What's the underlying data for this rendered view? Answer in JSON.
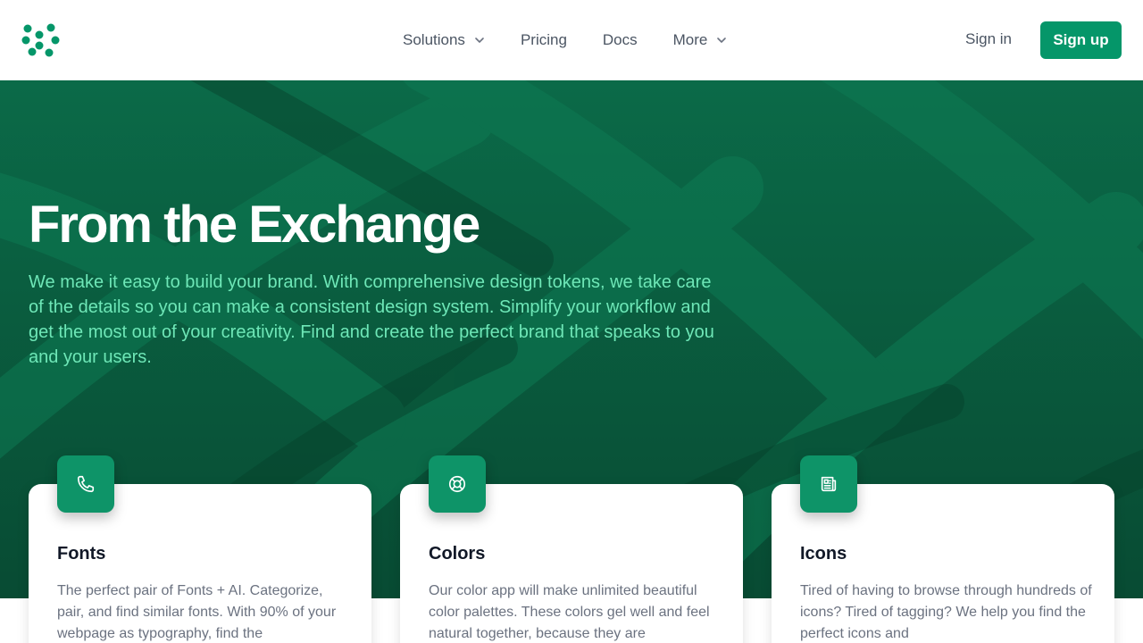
{
  "colors": {
    "brand": "#059669",
    "hero_bg": "#0a5a3e",
    "hero_text": "#6ee7b7"
  },
  "nav": {
    "logo_icon": "dots-logo-icon",
    "links": [
      {
        "label": "Solutions",
        "has_dropdown": true
      },
      {
        "label": "Pricing",
        "has_dropdown": false
      },
      {
        "label": "Docs",
        "has_dropdown": false
      },
      {
        "label": "More",
        "has_dropdown": true
      }
    ],
    "signin": "Sign in",
    "signup": "Sign up"
  },
  "hero": {
    "title": "From the Exchange",
    "description": "We make it easy to build your brand. With comprehensive design tokens, we take care of the details so you can make a consistent design system. Simplify your workflow and get the most out of your creativity. Find and create the perfect brand that speaks to you and your users."
  },
  "cards": [
    {
      "icon": "phone-icon",
      "title": "Fonts",
      "text": "The perfect pair of Fonts + AI. Categorize, pair, and find similar fonts. With 90% of your webpage as typography, find the"
    },
    {
      "icon": "lifebuoy-icon",
      "title": "Colors",
      "text": "Our color app will make unlimited beautiful color palettes. These colors gel well and feel natural together, because they are"
    },
    {
      "icon": "newspaper-icon",
      "title": "Icons",
      "text": "Tired of having to browse through hundreds of icons? Tired of tagging? We help you find the perfect icons and"
    }
  ]
}
